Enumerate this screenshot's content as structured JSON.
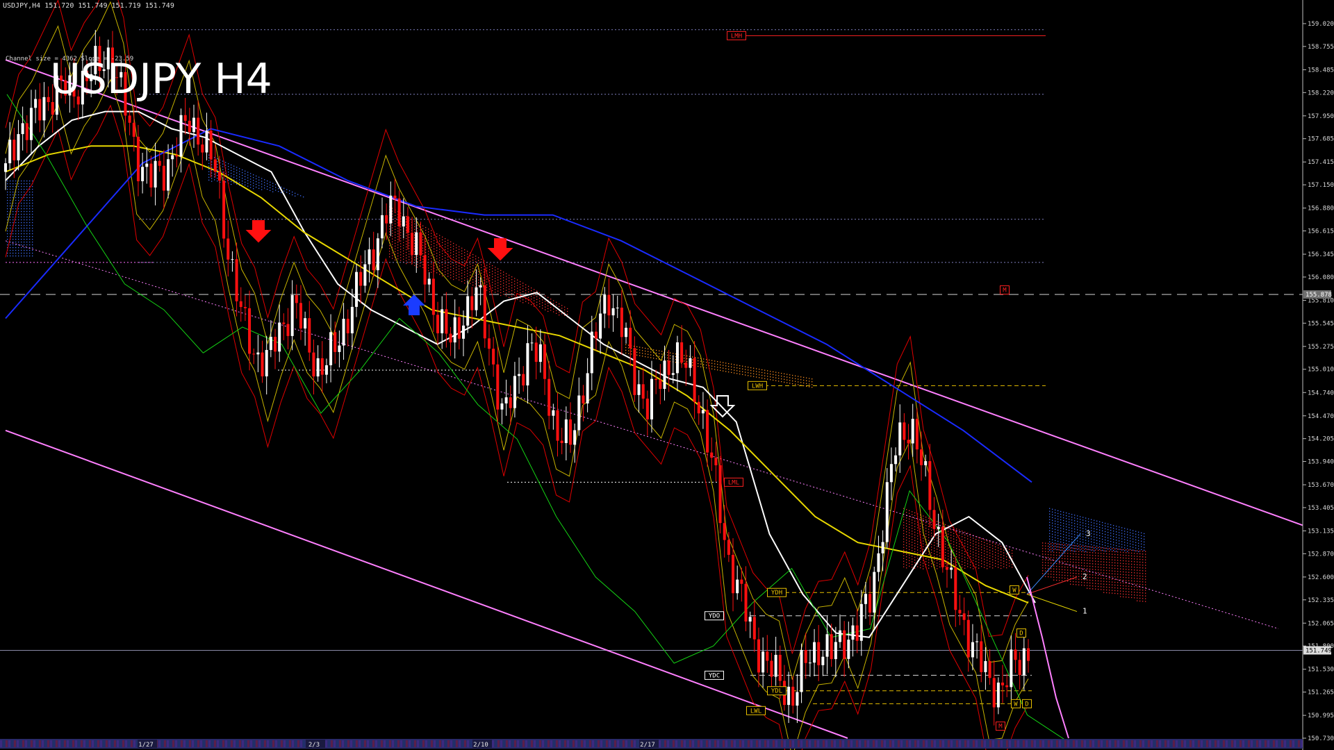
{
  "header": {
    "symbol_line": "USDJPY,H4  151.720 151.749 151.719 151.749",
    "channel_info": "Channel size = 4362 Slope = -23.59",
    "title": "USDJPY H4"
  },
  "chart_data": {
    "type": "candlestick",
    "symbol": "USDJPY",
    "timeframe": "H4",
    "ohlc_last": {
      "open": 151.72,
      "high": 151.749,
      "low": 151.719,
      "close": 151.749
    },
    "current_price": "151.749",
    "marked_price": "155.878",
    "price_axis": {
      "ylim": [
        150.73,
        159.02
      ],
      "ticks": [
        "159.020",
        "158.755",
        "158.485",
        "158.220",
        "157.950",
        "157.685",
        "157.415",
        "157.150",
        "156.880",
        "156.615",
        "156.345",
        "156.080",
        "155.810",
        "155.545",
        "155.275",
        "155.010",
        "154.740",
        "154.470",
        "154.205",
        "153.940",
        "153.670",
        "153.405",
        "153.135",
        "152.870",
        "152.600",
        "152.335",
        "152.065",
        "151.800",
        "151.530",
        "151.265",
        "150.995",
        "150.730"
      ]
    },
    "date_labels": [
      "1/27",
      "2/3",
      "2/10",
      "2/17"
    ],
    "close_path": [
      157.3,
      157.8,
      157.9,
      158.1,
      158.3,
      158.2,
      158.4,
      158.5,
      158.7,
      158.1,
      157.5,
      157.2,
      157.3,
      157.6,
      157.9,
      157.7,
      157.3,
      156.4,
      155.6,
      155.2,
      155.1,
      155.5,
      155.8,
      155.3,
      155.0,
      155.2,
      155.6,
      156.0,
      156.4,
      156.8,
      156.9,
      156.5,
      156.1,
      155.6,
      155.3,
      155.7,
      155.9,
      155.2,
      154.4,
      154.9,
      155.3,
      155.0,
      154.3,
      154.1,
      154.8,
      155.4,
      155.9,
      155.5,
      154.9,
      154.6,
      154.9,
      155.2,
      155.0,
      154.6,
      153.8,
      152.9,
      152.4,
      151.9,
      151.6,
      151.4,
      151.2,
      151.6,
      151.8,
      151.7,
      151.9,
      152.0,
      152.4,
      153.3,
      154.2,
      154.4,
      153.8,
      153.2,
      152.5,
      152.1,
      151.7,
      151.4,
      151.3,
      151.6,
      151.75
    ],
    "series": [
      {
        "name": "SMA white",
        "color": "#ffffff",
        "values": [
          157.2,
          157.6,
          157.9,
          158.0,
          158.0,
          157.8,
          157.7,
          157.5,
          157.3,
          156.6,
          156.0,
          155.7,
          155.5,
          155.3,
          155.5,
          155.8,
          155.9,
          155.6,
          155.3,
          155.1,
          154.9,
          154.8,
          154.4,
          153.1,
          152.4,
          151.95,
          151.9,
          152.5,
          153.1,
          153.3,
          153.0,
          152.3
        ]
      },
      {
        "name": "SMA yellow",
        "color": "#e8d800",
        "values": [
          157.3,
          157.5,
          157.6,
          157.6,
          157.5,
          157.3,
          157.0,
          156.6,
          156.3,
          156.0,
          155.7,
          155.6,
          155.5,
          155.4,
          155.2,
          155.0,
          154.7,
          154.3,
          153.8,
          153.3,
          153.0,
          152.9,
          152.8,
          152.5,
          152.3
        ]
      },
      {
        "name": "SMA blue",
        "color": "#1a2bff",
        "values": [
          155.6,
          156.5,
          157.4,
          157.8,
          157.6,
          157.2,
          156.9,
          156.8,
          156.8,
          156.5,
          156.1,
          155.7,
          155.3,
          154.8,
          154.3,
          153.7
        ]
      },
      {
        "name": "RSI green",
        "color": "#14d214",
        "values": [
          158.2,
          157.5,
          156.7,
          156.0,
          155.7,
          155.2,
          155.5,
          155.3,
          154.5,
          155.0,
          155.6,
          155.2,
          154.6,
          154.2,
          153.3,
          152.6,
          152.2,
          151.6,
          151.8,
          152.3,
          152.7,
          151.9,
          152.0,
          153.6,
          153.0,
          152.0,
          151.0,
          150.7
        ]
      }
    ],
    "channel_top": {
      "from": [
        "1/22",
        158.6
      ],
      "to": [
        "2/24",
        153.2
      ],
      "color": "#ff80ff"
    },
    "channel_bottom": {
      "from": [
        "1/22",
        154.3
      ],
      "to": [
        "2/18",
        150.73
      ],
      "color": "#ff80ff"
    },
    "level_tags": [
      {
        "label": "LMH",
        "price": 158.88,
        "color": "#ff2020"
      },
      {
        "label": "M",
        "price": 155.93,
        "color": "#ff2020"
      },
      {
        "label": "LWH",
        "price": 154.82,
        "color": "#e8c000"
      },
      {
        "label": "LML",
        "price": 153.7,
        "color": "#ff2020"
      },
      {
        "label": "YDH",
        "price": 152.42,
        "color": "#e8c000"
      },
      {
        "label": "YDO",
        "price": 152.15,
        "color": "#ffffff"
      },
      {
        "label": "YDC",
        "price": 151.46,
        "color": "#ffffff"
      },
      {
        "label": "YDL",
        "price": 151.28,
        "color": "#e8c000"
      },
      {
        "label": "LWL",
        "price": 151.05,
        "color": "#e8c000"
      },
      {
        "label": "W",
        "price": 152.45,
        "color": "#e8c000"
      },
      {
        "label": "D",
        "price": 151.95,
        "color": "#e8c000"
      },
      {
        "label": "W",
        "price": 151.13,
        "color": "#e8c000"
      },
      {
        "label": "D",
        "price": 151.13,
        "color": "#e8c000"
      },
      {
        "label": "M",
        "price": 150.87,
        "color": "#ff2020"
      }
    ],
    "projection_labels": [
      "3",
      "2",
      "1"
    ],
    "grid": false,
    "colors": {
      "bull": "#ffffff",
      "bear": "#ff1010",
      "cloud": "#ff3030",
      "cloud_alt": "#4070ff",
      "background": "#000000"
    }
  }
}
